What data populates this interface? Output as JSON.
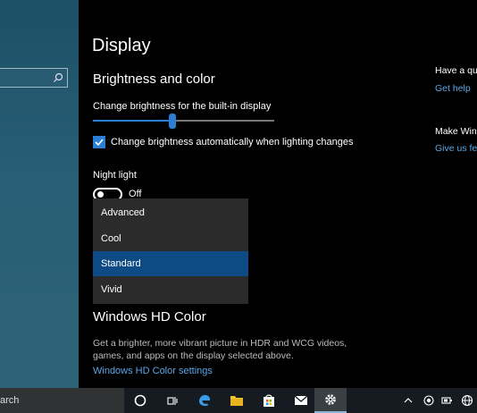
{
  "left_nav": {
    "search_placeholder": ""
  },
  "main": {
    "title": "Display",
    "brightness_section": "Brightness and color",
    "brightness_label": "Change brightness for the built-in display",
    "brightness_level": 0.44,
    "auto_brightness": {
      "checked": true,
      "label": "Change brightness automatically when lighting changes"
    },
    "night_light": {
      "label": "Night light",
      "state": "Off"
    },
    "color_profile_dropdown": {
      "options": [
        "Advanced",
        "Cool",
        "Standard",
        "Vivid"
      ],
      "selected": "Standard"
    },
    "hd_section": "Windows HD Color",
    "hd_description": "Get a brighter, more vibrant picture in HDR and WCG videos, games, and apps on the display selected above.",
    "hd_link": "Windows HD Color settings"
  },
  "right": {
    "question_title": "Have a que",
    "help_link": "Get help",
    "make_title": "Make Wind",
    "feedback_link": "Give us fee"
  },
  "taskbar": {
    "search_text": "arch",
    "icons": [
      "cortana-circle",
      "task-view",
      "edge",
      "file-explorer",
      "store",
      "mail",
      "settings"
    ],
    "active": "settings",
    "tray": [
      "chevron-up",
      "record",
      "battery",
      "network"
    ]
  },
  "colors": {
    "accent": "#2a7fd4",
    "selected_option": "#0e4b85",
    "link": "#5aa7e8"
  }
}
